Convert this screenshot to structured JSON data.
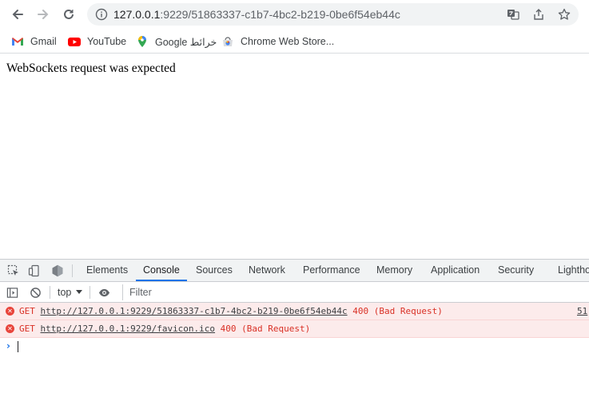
{
  "browser": {
    "url_host": "127.0.0.1",
    "url_path": ":9229/51863337-c1b7-4bc2-b219-0be6f54eb44c",
    "bookmarks": [
      {
        "label": "Gmail",
        "icon": "gmail-icon"
      },
      {
        "label": "YouTube",
        "icon": "youtube-icon"
      },
      {
        "label": "Google خرائط",
        "icon": "google-maps-icon"
      },
      {
        "label": "Chrome Web Store...",
        "icon": "chrome-web-store-icon"
      }
    ]
  },
  "page": {
    "message": "WebSockets request was expected"
  },
  "devtools": {
    "tabs": [
      "Elements",
      "Console",
      "Sources",
      "Network",
      "Performance",
      "Memory",
      "Application",
      "Security",
      "Lighthouse"
    ],
    "active_tab": "Console",
    "context": "top",
    "filter_placeholder": "Filter",
    "messages": [
      {
        "method": "GET",
        "url": "http://127.0.0.1:9229/51863337-c1b7-4bc2-b219-0be6f54eb44c",
        "status": "400 (Bad Request)",
        "source": "51"
      },
      {
        "method": "GET",
        "url": "http://127.0.0.1:9229/favicon.ico",
        "status": "400 (Bad Request)",
        "source": ""
      }
    ],
    "prompt_symbol": "›"
  },
  "colors": {
    "error_text": "#d93025",
    "error_bg": "#fcebeb",
    "active_tab_underline": "#1a73e8"
  }
}
